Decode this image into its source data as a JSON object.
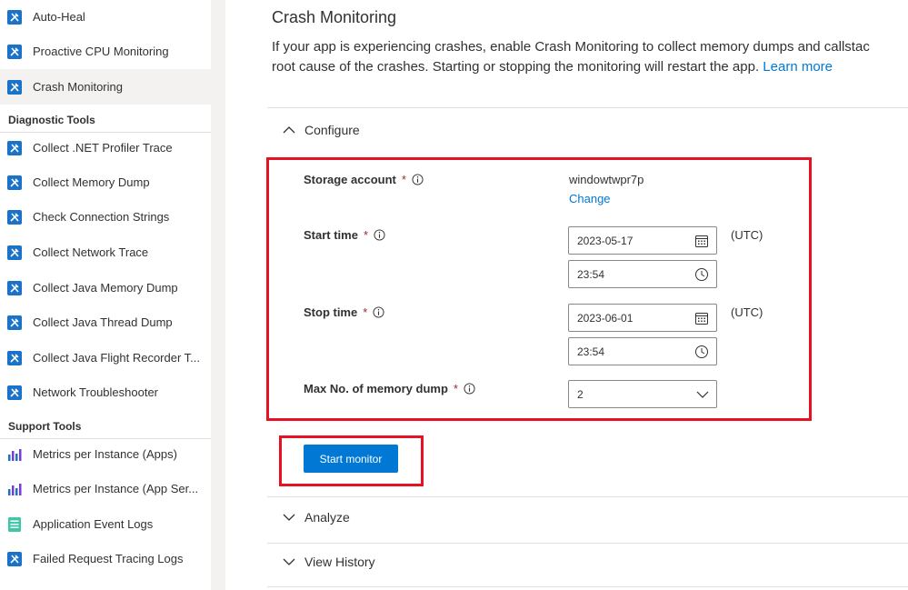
{
  "sidebar": {
    "items_top": [
      {
        "label": "Auto-Heal",
        "icon": "wrench-icon"
      },
      {
        "label": "Proactive CPU Monitoring",
        "icon": "wrench-icon"
      },
      {
        "label": "Crash Monitoring",
        "icon": "wrench-icon",
        "selected": true
      }
    ],
    "section_diagnostic": "Diagnostic Tools",
    "items_diagnostic": [
      {
        "label": "Collect .NET Profiler Trace",
        "icon": "wrench-icon"
      },
      {
        "label": "Collect Memory Dump",
        "icon": "wrench-icon"
      },
      {
        "label": "Check Connection Strings",
        "icon": "wrench-icon"
      },
      {
        "label": "Collect Network Trace",
        "icon": "wrench-icon"
      },
      {
        "label": "Collect Java Memory Dump",
        "icon": "wrench-icon"
      },
      {
        "label": "Collect Java Thread Dump",
        "icon": "wrench-icon"
      },
      {
        "label": "Collect Java Flight Recorder T...",
        "icon": "wrench-icon"
      },
      {
        "label": "Network Troubleshooter",
        "icon": "wrench-icon"
      }
    ],
    "section_support": "Support Tools",
    "items_support": [
      {
        "label": "Metrics per Instance (Apps)",
        "icon": "bar-chart-icon"
      },
      {
        "label": "Metrics per Instance (App Ser...",
        "icon": "bar-chart-icon"
      },
      {
        "label": "Application Event Logs",
        "icon": "document-list-icon"
      },
      {
        "label": "Failed Request Tracing Logs",
        "icon": "wrench-icon"
      }
    ]
  },
  "main": {
    "title": "Crash Monitoring",
    "description_line1": "If your app is experiencing crashes, enable Crash Monitoring to collect memory dumps and callstac",
    "description_line2": "root cause of the crashes. Starting or stopping the monitoring will restart the app.",
    "learn_more": "Learn more",
    "configure_label": "Configure",
    "analyze_label": "Analyze",
    "history_label": "View History",
    "storage_label": "Storage account",
    "storage_value": "windowtwpr7p",
    "change_link": "Change",
    "start_time_label": "Start time",
    "start_date": "2023-05-17",
    "start_clock": "23:54",
    "stop_time_label": "Stop time",
    "stop_date": "2023-06-01",
    "stop_clock": "23:54",
    "utc_label": "(UTC)",
    "max_dump_label": "Max No. of memory dump",
    "max_dump_value": "2",
    "required_mark": "*",
    "start_button": "Start monitor"
  },
  "colors": {
    "accent": "#0078d4",
    "highlight_box": "#e81123",
    "required": "#a4262c"
  }
}
